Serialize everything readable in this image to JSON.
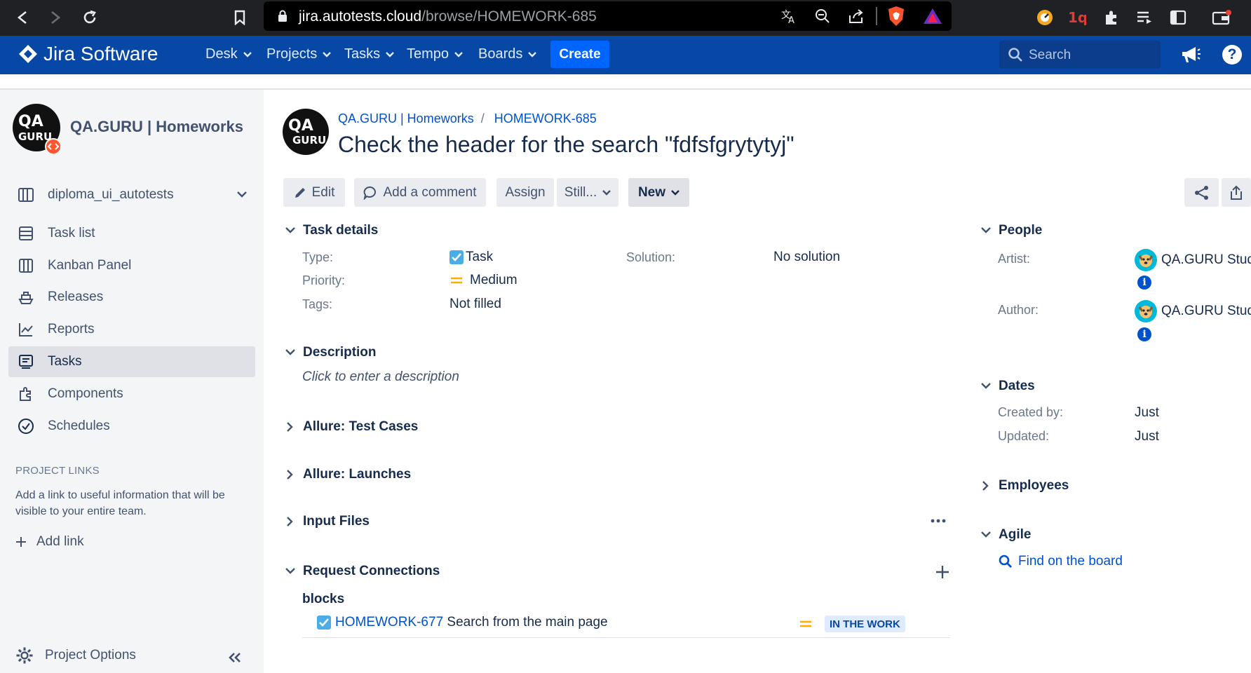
{
  "browser": {
    "url_domain": "jira.autotests.cloud",
    "url_path": "/browse/HOMEWORK-685"
  },
  "header": {
    "logo_text": "Jira Software",
    "nav": [
      "Desk",
      "Projects",
      "Tasks",
      "Tempo",
      "Boards"
    ],
    "create_label": "Create",
    "search_placeholder": "Search"
  },
  "sidebar": {
    "project_name": "QA.GURU | Homeworks",
    "board_selector": "diploma_ui_autotests",
    "items": [
      {
        "label": "Task list"
      },
      {
        "label": "Kanban Panel"
      },
      {
        "label": "Releases"
      },
      {
        "label": "Reports"
      },
      {
        "label": "Tasks"
      },
      {
        "label": "Components"
      },
      {
        "label": "Schedules"
      }
    ],
    "project_links_heading": "PROJECT LINKS",
    "project_links_text_1": "Add a link to useful information that will be",
    "project_links_text_2": "visible to your entire team.",
    "add_link": "Add link",
    "project_options": "Project Options"
  },
  "issue": {
    "breadcrumb_project": "QA.GURU | Homeworks",
    "breadcrumb_separator": "/",
    "breadcrumb_key": "HOMEWORK-685",
    "title": "Check the header for the search \"fdfsfgrytytyj\"",
    "toolbar": {
      "edit": "Edit",
      "comment": "Add a comment",
      "assign": "Assign",
      "still": "Still...",
      "status": "New"
    },
    "details": {
      "heading": "Task details",
      "type_label": "Type:",
      "type_value": "Task",
      "priority_label": "Priority:",
      "priority_value": "Medium",
      "tags_label": "Tags:",
      "tags_value": "Not filled",
      "solution_label": "Solution:",
      "solution_value": "No solution"
    },
    "description": {
      "heading": "Description",
      "placeholder": "Click to enter a description"
    },
    "collapsed_sections": [
      "Allure: Test Cases",
      "Allure: Launches",
      "Input Files"
    ],
    "links": {
      "heading": "Request Connections",
      "relation": "blocks",
      "issue_key": "HOMEWORK-677",
      "issue_summary": "Search from the main page",
      "issue_status": "IN THE WORK"
    }
  },
  "people": {
    "heading": "People",
    "artist_label": "Artist:",
    "artist_value": "QA.GURU Stude",
    "author_label": "Author:",
    "author_value": "QA.GURU Stude"
  },
  "dates": {
    "heading": "Dates",
    "created_label": "Created by:",
    "created_value": "Just",
    "updated_label": "Updated:",
    "updated_value": "Just"
  },
  "employees": {
    "heading": "Employees"
  },
  "agile": {
    "heading": "Agile",
    "find_link": "Find on the board"
  },
  "colors": {
    "header_bg": "#0747a6",
    "create_bg": "#0065ff",
    "link": "#0052cc",
    "status_badge_bg": "#deebff",
    "priority_medium": "#ffab00"
  }
}
